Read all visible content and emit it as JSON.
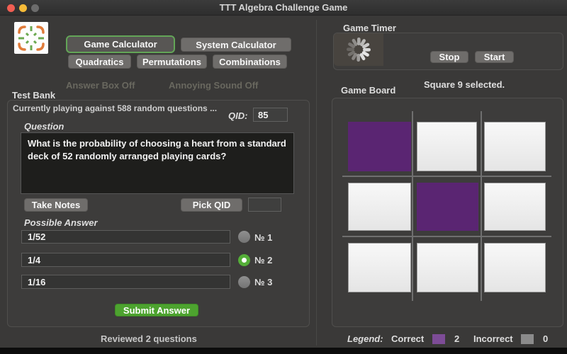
{
  "titlebar": {
    "title": "TTT Algebra Challenge Game"
  },
  "nav": {
    "game_calculator": "Game Calculator",
    "system_calculator": "System Calculator",
    "quadratics": "Quadratics",
    "permutations": "Permutations",
    "combinations": "Combinations",
    "answer_box_toggle": "Answer Box Off",
    "sound_toggle": "Annoying Sound Off"
  },
  "test_bank": {
    "label": "Test Bank",
    "status": "Currently playing against 588 random questions ...",
    "qid_label": "QID:",
    "qid_value": "85",
    "question_label": "Question",
    "question_text": "What is the probability of choosing a heart from a standard deck of 52 randomly arranged playing cards?",
    "take_notes": "Take Notes",
    "pick_qid": "Pick QID",
    "pick_qid_value": "",
    "possible_answer_label": "Possible Answer",
    "answers": [
      {
        "value": "1/52",
        "radio_label": "№ 1",
        "selected": false
      },
      {
        "value": "1/4",
        "radio_label": "№ 2",
        "selected": true
      },
      {
        "value": "1/16",
        "radio_label": "№ 3",
        "selected": false
      }
    ],
    "submit": "Submit Answer",
    "reviewed": "Reviewed 2 questions"
  },
  "timer": {
    "label": "Game Timer",
    "stop": "Stop",
    "start": "Start"
  },
  "board": {
    "selection_status": "Square 9 selected.",
    "label": "Game Board",
    "squares": [
      {
        "n": 1,
        "state": "correct"
      },
      {
        "n": 2,
        "state": "empty"
      },
      {
        "n": 3,
        "state": "empty"
      },
      {
        "n": 4,
        "state": "empty"
      },
      {
        "n": 5,
        "state": "correct"
      },
      {
        "n": 6,
        "state": "empty"
      },
      {
        "n": 7,
        "state": "empty"
      },
      {
        "n": 8,
        "state": "empty"
      },
      {
        "n": 9,
        "state": "empty"
      }
    ]
  },
  "legend": {
    "label": "Legend:",
    "correct_label": "Correct",
    "correct_count": "2",
    "incorrect_label": "Incorrect",
    "incorrect_count": "0"
  },
  "colors": {
    "correct_square": "#5a2572",
    "legend_correct": "#7d4c97",
    "legend_incorrect": "#8b8b8b",
    "accent_green": "#54ae38",
    "submit_green": "#4da32f"
  }
}
